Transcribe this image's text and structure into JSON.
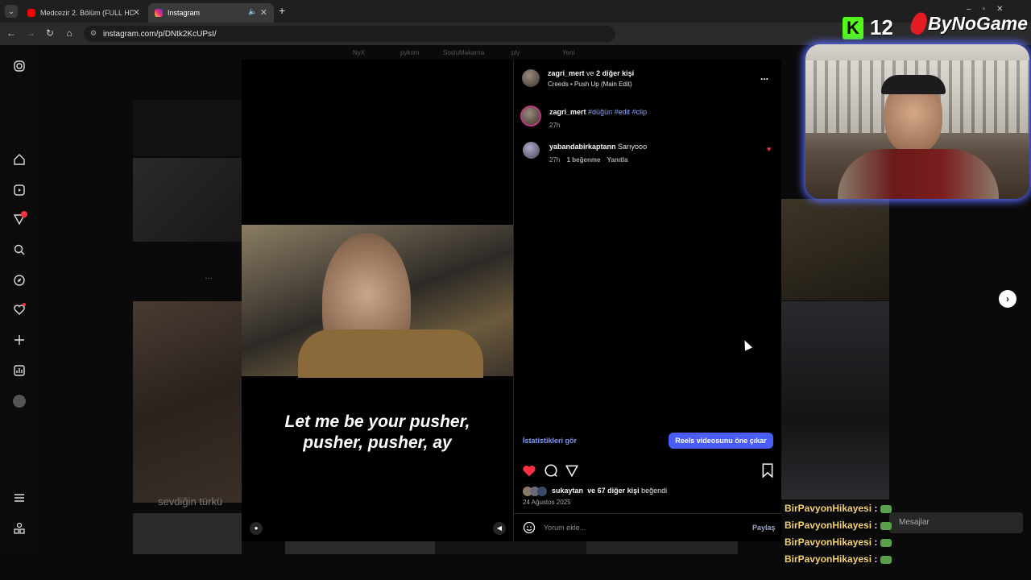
{
  "browser": {
    "tabs": [
      {
        "label": "Medcezir 2. Bölüm (FULL HD) -",
        "active": false
      },
      {
        "label": "Instagram",
        "active": true
      }
    ],
    "url": "instagram.com/p/DNtk2KcUPsI/"
  },
  "background_feed": {
    "top_labels": [
      "NyX",
      "pykom",
      "SosluMakarna",
      "ply",
      "Yeni"
    ],
    "partial_text": "sevdiğin türkü"
  },
  "post": {
    "video_caption_line1": "Let me be your pusher,",
    "video_caption_line2": "pusher, pusher, ay",
    "header": {
      "author": "zagri_mert",
      "coauthors": "ve",
      "coauthors_count": "2 diğer kişi",
      "audio": "Creeds • Push Up (Main Edit)",
      "more": "..."
    },
    "caption": {
      "author": "zagri_mert",
      "tags": "#düğün #edit #clip",
      "time": "27h"
    },
    "comments": [
      {
        "author": "yabandabirkaptann",
        "text": "Sarıyooo",
        "time": "27h",
        "likes": "1 beğenme",
        "reply": "Yanıtla"
      }
    ],
    "stats_link": "İstatistikleri gör",
    "promote_button": "Reels videosunu öne çıkar",
    "liked_by_user": "sukaytan",
    "liked_by_rest": "ve 67 diğer kişi",
    "liked_suffix": "beğendi",
    "date": "24 Ağustos 2025",
    "comment_placeholder": "Yorum ekle...",
    "share_label": "Paylaş"
  },
  "overlay": {
    "kick_count": "12",
    "brand": "ByNoGame",
    "chat_messages": [
      {
        "user": "BirPavyonHikayesi",
        "sep": ":"
      },
      {
        "user": "BirPavyonHikayesi",
        "sep": ":"
      },
      {
        "user": "BirPavyonHikayesi",
        "sep": ":"
      },
      {
        "user": "BirPavyonHikayesi",
        "sep": ":"
      }
    ],
    "messages_label": "Mesajlar"
  },
  "colors": {
    "accent_blue": "#4a5df9",
    "like_red": "#ff3040",
    "link_blue": "#8fa8ff",
    "chat_name": "#f5d36b"
  }
}
